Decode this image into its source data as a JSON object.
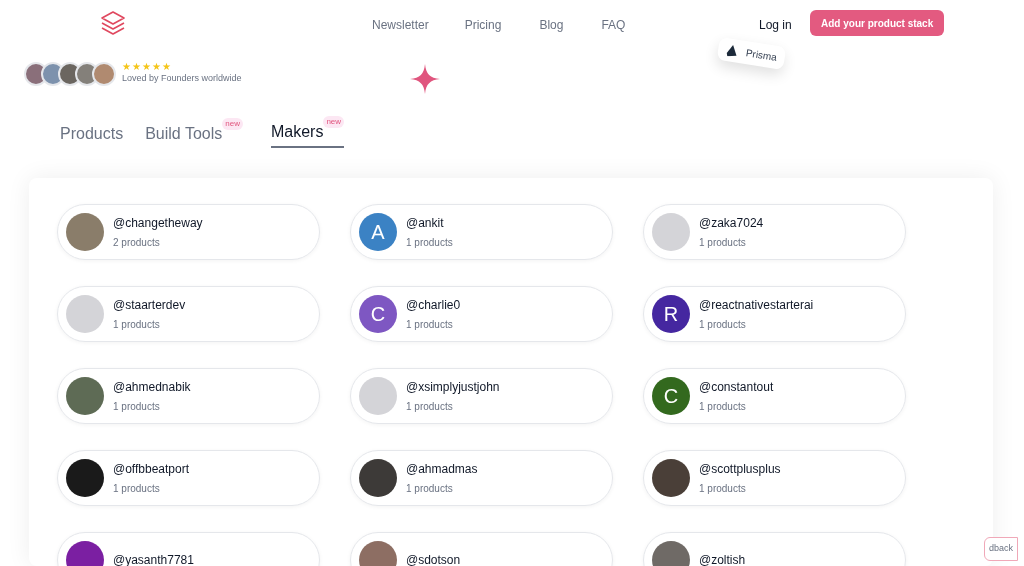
{
  "nav": {
    "links": [
      "Newsletter",
      "Pricing",
      "Blog",
      "FAQ"
    ],
    "login": "Log in",
    "cta": "Add your product stack"
  },
  "social_proof": {
    "stars": 5,
    "text": "Loved by Founders worldwide"
  },
  "floating_badge": {
    "label": "Prisma"
  },
  "tabs": [
    {
      "label": "Products",
      "selected": false
    },
    {
      "label": "Build Tools",
      "selected": false,
      "badge": "new"
    },
    {
      "label": "Makers",
      "selected": true,
      "badge": "new"
    }
  ],
  "makers": [
    {
      "handle": "@changetheway",
      "products": "2 products",
      "kind": "photo"
    },
    {
      "handle": "@ankit",
      "products": "1 products",
      "kind": "letter",
      "letter": "A",
      "color": "#3b82c4"
    },
    {
      "handle": "@zaka7024",
      "products": "1 products",
      "kind": "blank"
    },
    {
      "handle": "@staarterdev",
      "products": "1 products",
      "kind": "blank"
    },
    {
      "handle": "@charlie0",
      "products": "1 products",
      "kind": "letter",
      "letter": "C",
      "color": "#7e57c2"
    },
    {
      "handle": "@reactnativestarterai",
      "products": "1 products",
      "kind": "letter",
      "letter": "R",
      "color": "#4527a0"
    },
    {
      "handle": "@ahmednabik",
      "products": "1 products",
      "kind": "photo"
    },
    {
      "handle": "@xsimplyjustjohn",
      "products": "1 products",
      "kind": "blank"
    },
    {
      "handle": "@constantout",
      "products": "1 products",
      "kind": "letter",
      "letter": "C",
      "color": "#33691e"
    },
    {
      "handle": "@offbbeatport",
      "products": "1 products",
      "kind": "photo"
    },
    {
      "handle": "@ahmadmas",
      "products": "1 products",
      "kind": "photo"
    },
    {
      "handle": "@scottplusplus",
      "products": "1 products",
      "kind": "photo"
    },
    {
      "handle": "@yasanth7781",
      "kind": "letter",
      "color": "#7b1fa2"
    },
    {
      "handle": "@sdotson",
      "kind": "photo"
    },
    {
      "handle": "@zoltish",
      "kind": "photo"
    }
  ],
  "feedback_tab": "dback"
}
